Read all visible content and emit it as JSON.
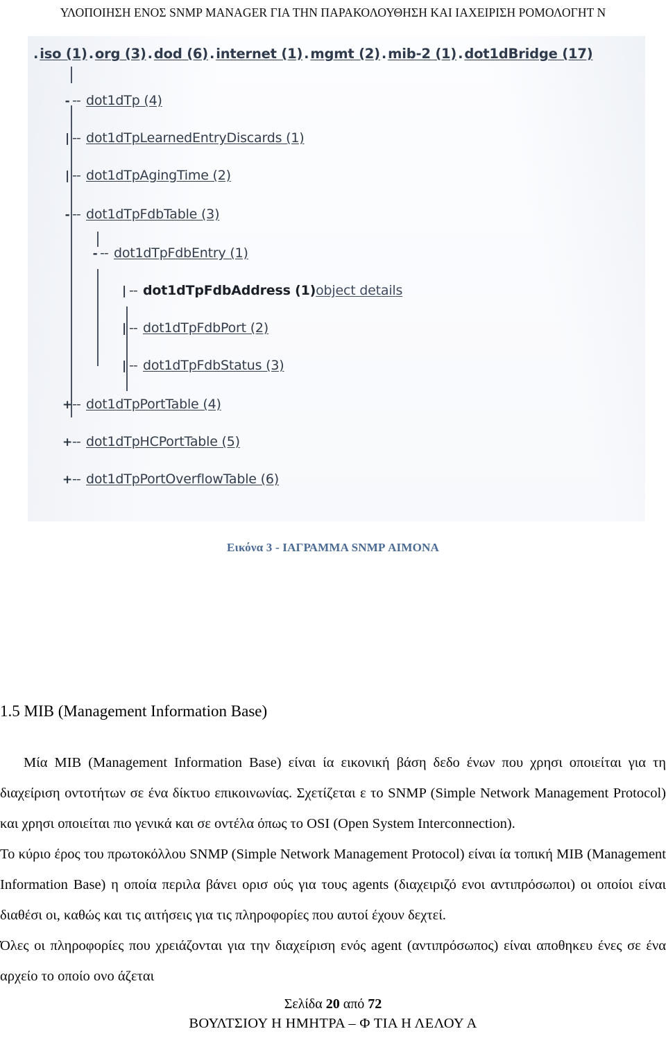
{
  "header": {
    "running_title": "ΥΛΟΠΟΙΗΣΗ ΕΝΟΣ SNMP MANAGER ΓΙΑ ΤΗΝ ΠΑΡΑΚΟΛΟΥΘΗΣΗ ΚΑΙ   ΙΑΧΕΙΡΙΣΗ   ΡΟΜΟΛΟΓΗΤ  Ν"
  },
  "figure": {
    "caption": "Εικόνα 3 -   ΙΑΓΡΑΜΜΑ SNMP   ΑΙΜΟΝΑ",
    "caption_color": "#4a6a93",
    "mib_path": [
      {
        "dot": ".",
        "label": "iso (1)"
      },
      {
        "dot": ".",
        "label": "org (3)"
      },
      {
        "dot": ".",
        "label": "dod (6)"
      },
      {
        "dot": ".",
        "label": "internet (1)"
      },
      {
        "dot": ".",
        "label": "mgmt (2)"
      },
      {
        "dot": ".",
        "label": "mib-2 (1)"
      },
      {
        "dot": ".",
        "label": "dot1dBridge (17)"
      }
    ],
    "tree_nodes": [
      {
        "expander": "-",
        "dash": "--",
        "label": "dot1dTp (4)",
        "extra": ""
      },
      {
        "expander": "|",
        "dash": "--",
        "label": "dot1dTpLearnedEntryDiscards (1)",
        "extra": ""
      },
      {
        "expander": "|",
        "dash": "--",
        "label": "dot1dTpAgingTime (2)",
        "extra": ""
      },
      {
        "expander": "-",
        "dash": "--",
        "label": "dot1dTpFdbTable (3)",
        "extra": ""
      },
      {
        "expander": "-",
        "dash": "--",
        "label": "dot1dTpFdbEntry (1)",
        "extra": ""
      },
      {
        "expander": "|",
        "dash": "--",
        "label": "dot1dTpFdbAddress (1)",
        "extra": "object details"
      },
      {
        "expander": "|",
        "dash": "--",
        "label": "dot1dTpFdbPort (2)",
        "extra": ""
      },
      {
        "expander": "|",
        "dash": "--",
        "label": "dot1dTpFdbStatus (3)",
        "extra": ""
      },
      {
        "expander": "+",
        "dash": "--",
        "label": "dot1dTpPortTable (4)",
        "extra": ""
      },
      {
        "expander": "+",
        "dash": "--",
        "label": "dot1dTpHCPortTable (5)",
        "extra": ""
      },
      {
        "expander": "+",
        "dash": "--",
        "label": "dot1dTpPortOverflowTable (6)",
        "extra": ""
      }
    ]
  },
  "content": {
    "section_number_title": "1.5 MIB (Management Information Base)",
    "paragraph_1": "Μία MIB (Management Information Base) είναι   ία εικονική βάση δεδο  ένων που χρησι  οποιείται για τη διαχείριση οντοτήτων σε ένα δίκτυο επικοινωνίας. Σχετίζεται   ε το SNMP (Simple Network Management Protocol) και χρησι  οποιείται πιο γενικά και σε   οντέλα όπως το OSI (Open System Interconnection).",
    "paragraph_2": "Το κύριο    έρος του πρωτοκόλλου SNMP (Simple Network Management Protocol) είναι   ία τοπική MIB (Management Information Base) η οποία περιλα  βάνει ορισ  ούς για τους agents (διαχειριζό  ενοι αντιπρόσωποι) οι οποίοι είναι διαθέσι  οι, καθώς και τις αιτήσεις για τις πληροφορίες που αυτοί έχουν δεχτεί.",
    "paragraph_3": "Όλες οι πληροφορίες που χρειάζονται για την διαχείριση ενός agent (αντιπρόσωπος) είναι αποθηκευ  ένες σε ένα αρχείο το οποίο ονο  άζεται"
  },
  "footer": {
    "page_label": "Σελίδα",
    "page_number": "20",
    "of_label": "από",
    "total_pages": "72",
    "authors": "ΒΟΥΛΤΣΙΟΥ  Η   ΗΜΗΤΡΑ – Φ   ΤΙΑ   Η ΛΕΛΟΥ  Α"
  }
}
